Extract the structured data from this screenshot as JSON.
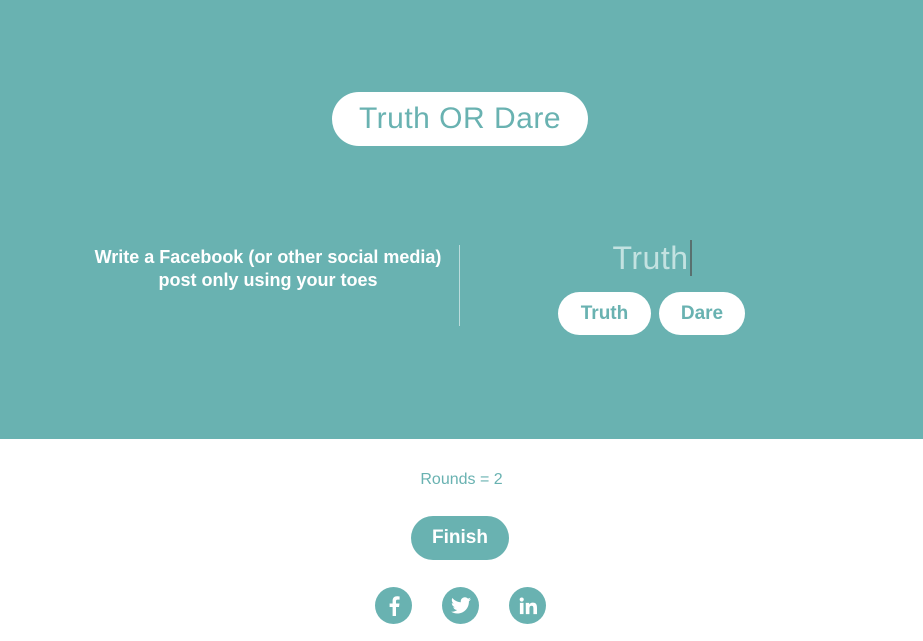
{
  "header": {
    "title": "Truth OR Dare"
  },
  "challenge": {
    "prompt": "Write a Facebook (or other social media) post only using your toes"
  },
  "selection": {
    "current": "Truth",
    "truth_label": "Truth",
    "dare_label": "Dare"
  },
  "footer": {
    "rounds_text": "Rounds = 2",
    "finish_label": "Finish",
    "social": [
      {
        "icon": "facebook-icon"
      },
      {
        "icon": "twitter-icon"
      },
      {
        "icon": "linkedin-icon"
      }
    ]
  },
  "colors": {
    "accent": "#69b2b1",
    "background": "#ffffff",
    "faded_text": "#c3e2e1"
  }
}
